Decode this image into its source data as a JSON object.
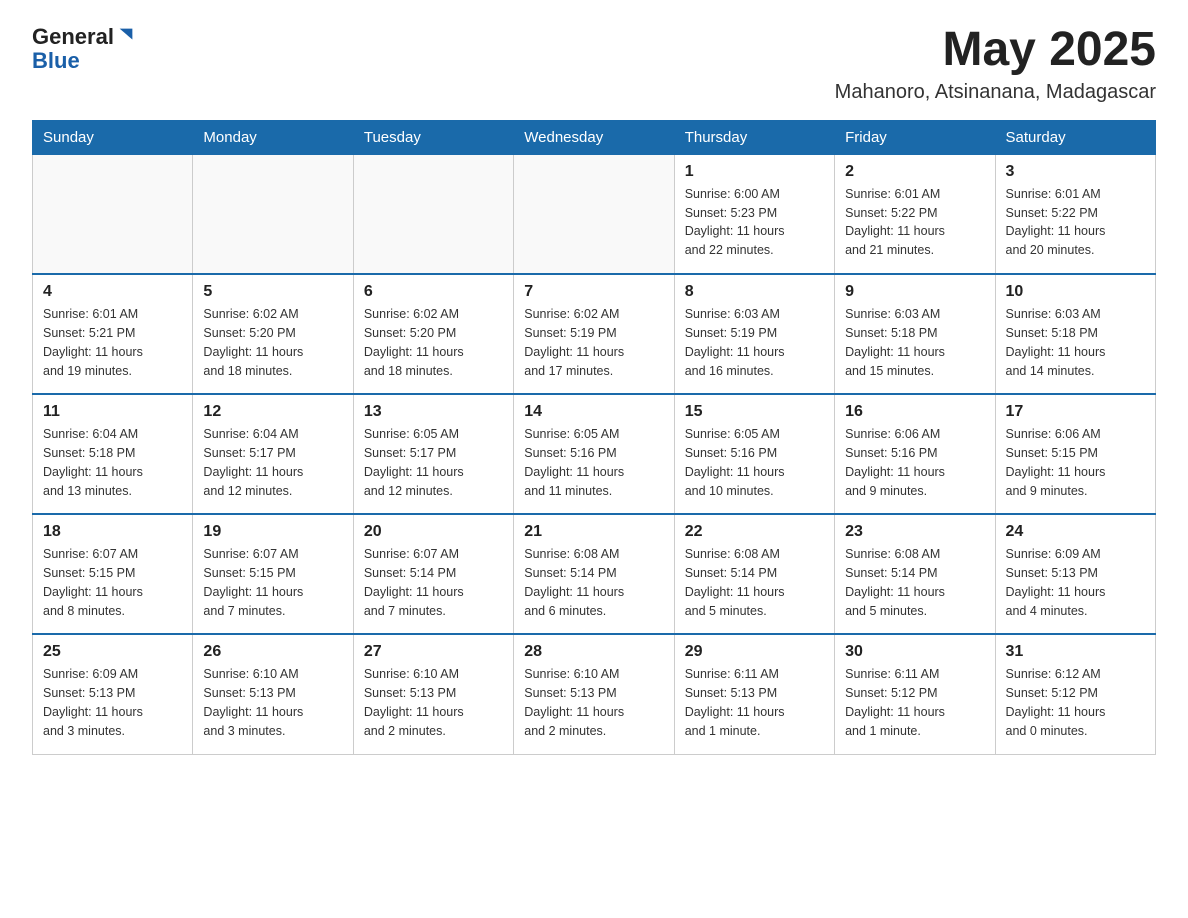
{
  "header": {
    "logo_general": "General",
    "logo_blue": "Blue",
    "month_title": "May 2025",
    "location": "Mahanoro, Atsinanana, Madagascar"
  },
  "days_of_week": [
    "Sunday",
    "Monday",
    "Tuesday",
    "Wednesday",
    "Thursday",
    "Friday",
    "Saturday"
  ],
  "weeks": [
    [
      {
        "day": "",
        "info": ""
      },
      {
        "day": "",
        "info": ""
      },
      {
        "day": "",
        "info": ""
      },
      {
        "day": "",
        "info": ""
      },
      {
        "day": "1",
        "info": "Sunrise: 6:00 AM\nSunset: 5:23 PM\nDaylight: 11 hours\nand 22 minutes."
      },
      {
        "day": "2",
        "info": "Sunrise: 6:01 AM\nSunset: 5:22 PM\nDaylight: 11 hours\nand 21 minutes."
      },
      {
        "day": "3",
        "info": "Sunrise: 6:01 AM\nSunset: 5:22 PM\nDaylight: 11 hours\nand 20 minutes."
      }
    ],
    [
      {
        "day": "4",
        "info": "Sunrise: 6:01 AM\nSunset: 5:21 PM\nDaylight: 11 hours\nand 19 minutes."
      },
      {
        "day": "5",
        "info": "Sunrise: 6:02 AM\nSunset: 5:20 PM\nDaylight: 11 hours\nand 18 minutes."
      },
      {
        "day": "6",
        "info": "Sunrise: 6:02 AM\nSunset: 5:20 PM\nDaylight: 11 hours\nand 18 minutes."
      },
      {
        "day": "7",
        "info": "Sunrise: 6:02 AM\nSunset: 5:19 PM\nDaylight: 11 hours\nand 17 minutes."
      },
      {
        "day": "8",
        "info": "Sunrise: 6:03 AM\nSunset: 5:19 PM\nDaylight: 11 hours\nand 16 minutes."
      },
      {
        "day": "9",
        "info": "Sunrise: 6:03 AM\nSunset: 5:18 PM\nDaylight: 11 hours\nand 15 minutes."
      },
      {
        "day": "10",
        "info": "Sunrise: 6:03 AM\nSunset: 5:18 PM\nDaylight: 11 hours\nand 14 minutes."
      }
    ],
    [
      {
        "day": "11",
        "info": "Sunrise: 6:04 AM\nSunset: 5:18 PM\nDaylight: 11 hours\nand 13 minutes."
      },
      {
        "day": "12",
        "info": "Sunrise: 6:04 AM\nSunset: 5:17 PM\nDaylight: 11 hours\nand 12 minutes."
      },
      {
        "day": "13",
        "info": "Sunrise: 6:05 AM\nSunset: 5:17 PM\nDaylight: 11 hours\nand 12 minutes."
      },
      {
        "day": "14",
        "info": "Sunrise: 6:05 AM\nSunset: 5:16 PM\nDaylight: 11 hours\nand 11 minutes."
      },
      {
        "day": "15",
        "info": "Sunrise: 6:05 AM\nSunset: 5:16 PM\nDaylight: 11 hours\nand 10 minutes."
      },
      {
        "day": "16",
        "info": "Sunrise: 6:06 AM\nSunset: 5:16 PM\nDaylight: 11 hours\nand 9 minutes."
      },
      {
        "day": "17",
        "info": "Sunrise: 6:06 AM\nSunset: 5:15 PM\nDaylight: 11 hours\nand 9 minutes."
      }
    ],
    [
      {
        "day": "18",
        "info": "Sunrise: 6:07 AM\nSunset: 5:15 PM\nDaylight: 11 hours\nand 8 minutes."
      },
      {
        "day": "19",
        "info": "Sunrise: 6:07 AM\nSunset: 5:15 PM\nDaylight: 11 hours\nand 7 minutes."
      },
      {
        "day": "20",
        "info": "Sunrise: 6:07 AM\nSunset: 5:14 PM\nDaylight: 11 hours\nand 7 minutes."
      },
      {
        "day": "21",
        "info": "Sunrise: 6:08 AM\nSunset: 5:14 PM\nDaylight: 11 hours\nand 6 minutes."
      },
      {
        "day": "22",
        "info": "Sunrise: 6:08 AM\nSunset: 5:14 PM\nDaylight: 11 hours\nand 5 minutes."
      },
      {
        "day": "23",
        "info": "Sunrise: 6:08 AM\nSunset: 5:14 PM\nDaylight: 11 hours\nand 5 minutes."
      },
      {
        "day": "24",
        "info": "Sunrise: 6:09 AM\nSunset: 5:13 PM\nDaylight: 11 hours\nand 4 minutes."
      }
    ],
    [
      {
        "day": "25",
        "info": "Sunrise: 6:09 AM\nSunset: 5:13 PM\nDaylight: 11 hours\nand 3 minutes."
      },
      {
        "day": "26",
        "info": "Sunrise: 6:10 AM\nSunset: 5:13 PM\nDaylight: 11 hours\nand 3 minutes."
      },
      {
        "day": "27",
        "info": "Sunrise: 6:10 AM\nSunset: 5:13 PM\nDaylight: 11 hours\nand 2 minutes."
      },
      {
        "day": "28",
        "info": "Sunrise: 6:10 AM\nSunset: 5:13 PM\nDaylight: 11 hours\nand 2 minutes."
      },
      {
        "day": "29",
        "info": "Sunrise: 6:11 AM\nSunset: 5:13 PM\nDaylight: 11 hours\nand 1 minute."
      },
      {
        "day": "30",
        "info": "Sunrise: 6:11 AM\nSunset: 5:12 PM\nDaylight: 11 hours\nand 1 minute."
      },
      {
        "day": "31",
        "info": "Sunrise: 6:12 AM\nSunset: 5:12 PM\nDaylight: 11 hours\nand 0 minutes."
      }
    ]
  ]
}
